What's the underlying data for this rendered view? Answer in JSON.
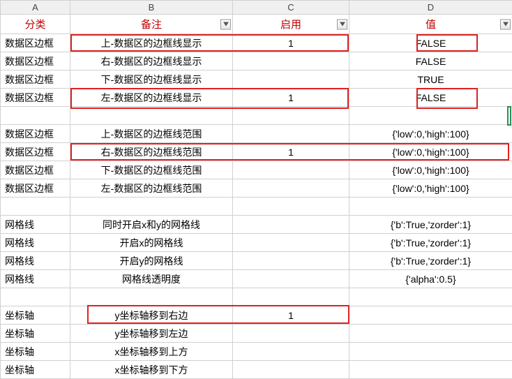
{
  "columns": {
    "A": "A",
    "B": "B",
    "C": "C",
    "D": "D"
  },
  "headers": {
    "A": "分类",
    "B": "备注",
    "C": "启用",
    "D": "值"
  },
  "rows": [
    {
      "A": "数据区边框",
      "B": "上-数据区的边框线显示",
      "C": "1",
      "D": "FALSE"
    },
    {
      "A": "数据区边框",
      "B": "右-数据区的边框线显示",
      "C": "",
      "D": "FALSE"
    },
    {
      "A": "数据区边框",
      "B": "下-数据区的边框线显示",
      "C": "",
      "D": "TRUE"
    },
    {
      "A": "数据区边框",
      "B": "左-数据区的边框线显示",
      "C": "1",
      "D": "FALSE"
    },
    {
      "A": "",
      "B": "",
      "C": "",
      "D": ""
    },
    {
      "A": "数据区边框",
      "B": "上-数据区的边框线范围",
      "C": "",
      "D": "{'low':0,'high':100}"
    },
    {
      "A": "数据区边框",
      "B": "右-数据区的边框线范围",
      "C": "1",
      "D": "{'low':0,'high':100}"
    },
    {
      "A": "数据区边框",
      "B": "下-数据区的边框线范围",
      "C": "",
      "D": "{'low':0,'high':100}"
    },
    {
      "A": "数据区边框",
      "B": "左-数据区的边框线范围",
      "C": "",
      "D": "{'low':0,'high':100}"
    },
    {
      "A": "",
      "B": "",
      "C": "",
      "D": ""
    },
    {
      "A": "网格线",
      "B": "同时开启x和y的网格线",
      "C": "",
      "D": "{'b':True,'zorder':1}"
    },
    {
      "A": "网格线",
      "B": "开启x的网格线",
      "C": "",
      "D": "{'b':True,'zorder':1}"
    },
    {
      "A": "网格线",
      "B": "开启y的网格线",
      "C": "",
      "D": "{'b':True,'zorder':1}"
    },
    {
      "A": "网格线",
      "B": "网格线透明度",
      "C": "",
      "D": "{'alpha':0.5}"
    },
    {
      "A": "",
      "B": "",
      "C": "",
      "D": ""
    },
    {
      "A": "坐标轴",
      "B": "y坐标轴移到右边",
      "C": "1",
      "D": ""
    },
    {
      "A": "坐标轴",
      "B": "y坐标轴移到左边",
      "C": "",
      "D": ""
    },
    {
      "A": "坐标轴",
      "B": "x坐标轴移到上方",
      "C": "",
      "D": ""
    },
    {
      "A": "坐标轴",
      "B": "x坐标轴移到下方",
      "C": "",
      "D": ""
    }
  ]
}
